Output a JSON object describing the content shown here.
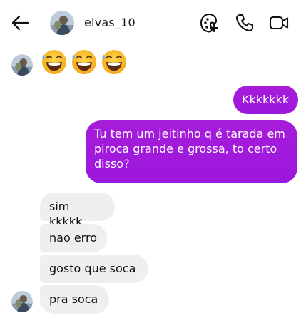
{
  "header": {
    "username": "elvas_10",
    "back_icon": "arrow-left-icon",
    "effects_icon": "effects-icon",
    "call_icon": "phone-icon",
    "video_icon": "video-camera-icon"
  },
  "colors": {
    "sent_bubble": "#a21bdb",
    "received_bubble": "#efefef",
    "text_dark": "#111111",
    "text_light": "#ffffff"
  },
  "messages": [
    {
      "from": "them",
      "kind": "emoji",
      "emoji_name": "grinning-sweat-face",
      "count": 3
    },
    {
      "from": "me",
      "text": "Kkkkkkk"
    },
    {
      "from": "me",
      "text": "Tu tem um jeitinho q é tarada em piroca grande e grossa, to certo disso?"
    },
    {
      "from": "them",
      "text": "sim kkkkk"
    },
    {
      "from": "them",
      "text": "nao erro"
    },
    {
      "from": "them",
      "text": "gosto que soca"
    },
    {
      "from": "them",
      "text": "pra soca"
    }
  ]
}
